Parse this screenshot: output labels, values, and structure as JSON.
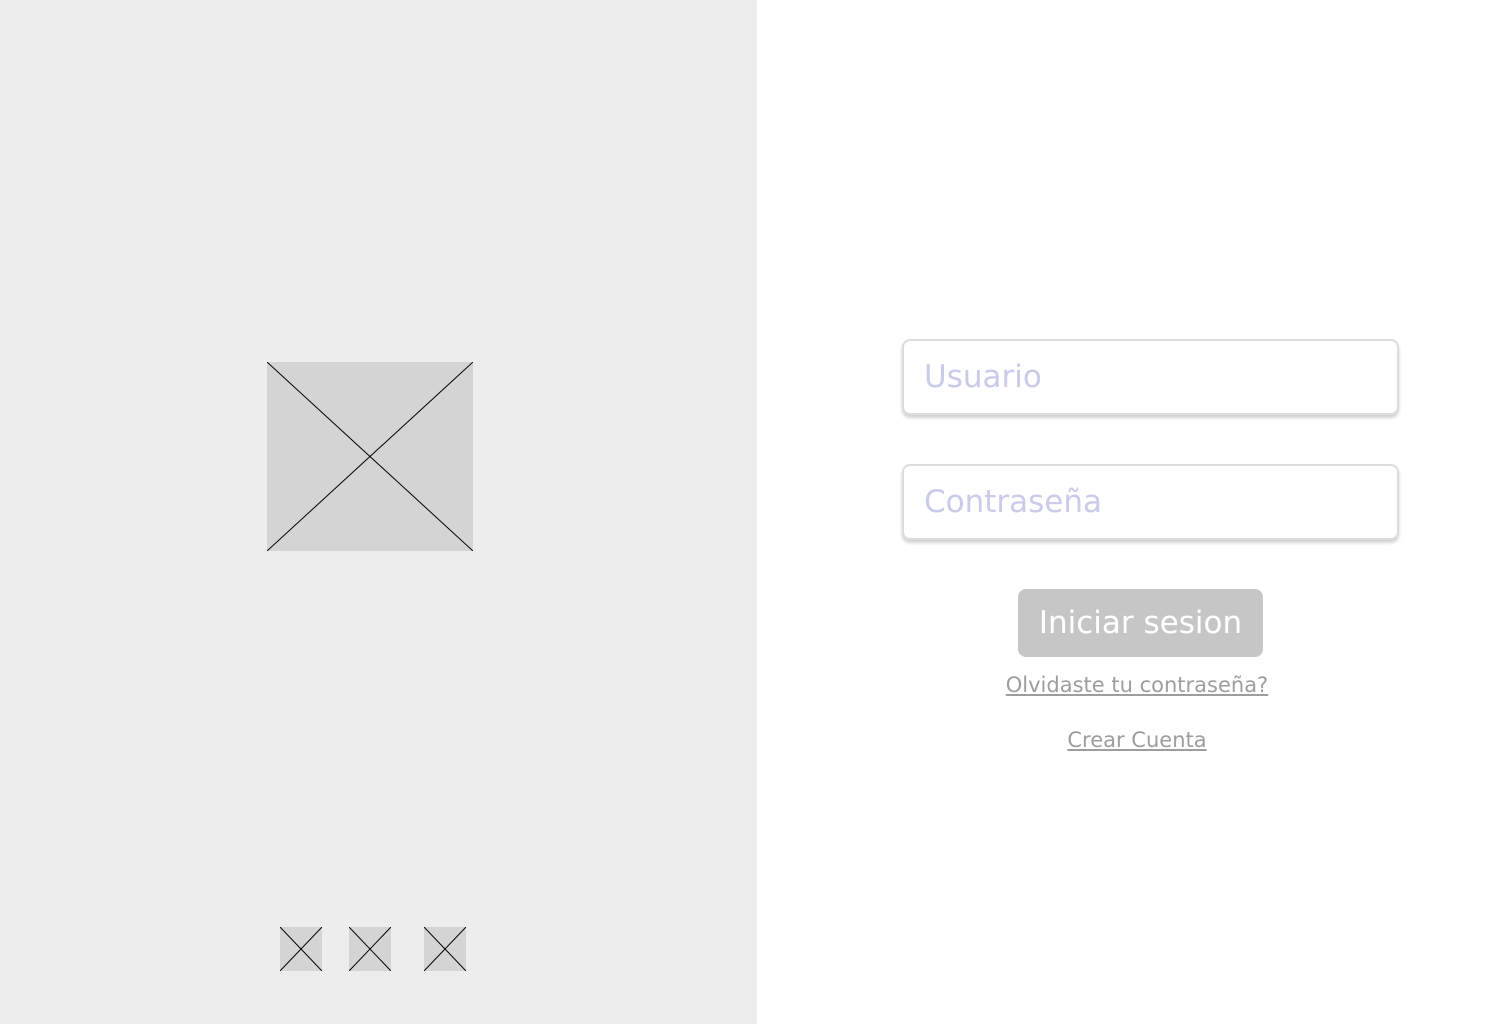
{
  "login_form": {
    "username_placeholder": "Usuario",
    "password_placeholder": "Contraseña",
    "submit_label": "Iniciar sesion",
    "forgot_password_link": "Olvidaste tu contraseña?",
    "create_account_link": "Crear Cuenta"
  },
  "colors": {
    "left_panel_bg": "#ededed",
    "placeholder_box": "#d4d4d4",
    "placeholder_text": "#c9cbe8",
    "button_bg": "#c6c6c6",
    "link_text": "#9d9d9d"
  },
  "images": {
    "hero": "image-placeholder-icon",
    "carousel_thumbnails": [
      "image-placeholder-icon",
      "image-placeholder-icon",
      "image-placeholder-icon"
    ]
  }
}
